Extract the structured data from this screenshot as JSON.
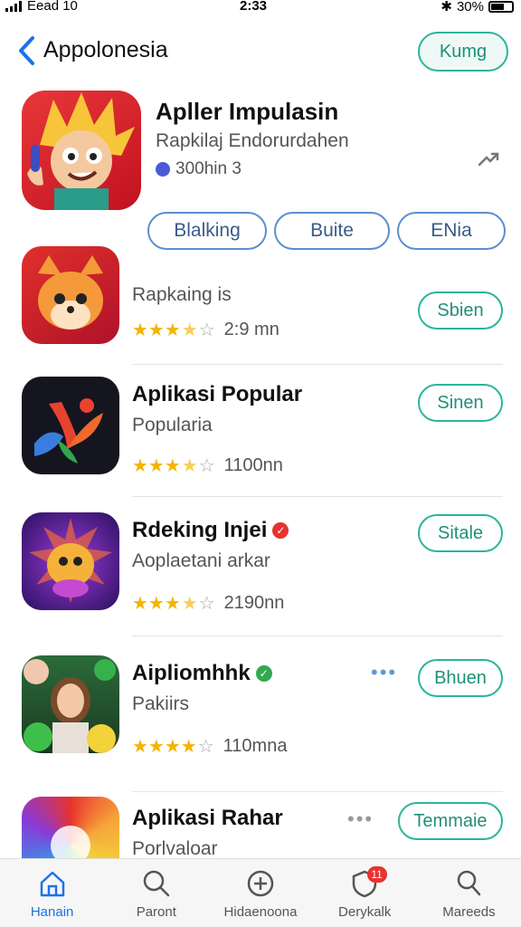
{
  "status": {
    "carrier": "Eead 10",
    "time": "2:33",
    "battery": "30%"
  },
  "header": {
    "title": "Appolonesia",
    "action_label": "Kumg"
  },
  "featured": {
    "title": "Apller Impulasin",
    "subtitle": "Rapkilaj Endorurdahen",
    "count": "300hin 3",
    "tabs": [
      "Blalking",
      "Buite",
      "ENia"
    ]
  },
  "apps": [
    {
      "name": "",
      "subtitle": "Rapkaing is",
      "rating_value": 3.5,
      "rating_text": "2:9 mn",
      "button": "Sbien",
      "badge": "",
      "more": ""
    },
    {
      "name": "Aplikasi Popular",
      "subtitle": "Popularia",
      "rating_value": 3.5,
      "rating_text": "1100nn",
      "button": "Sinen",
      "badge": "",
      "more": ""
    },
    {
      "name": "Rdeking Injei",
      "subtitle": "Aoplaetani arkar",
      "rating_value": 3.5,
      "rating_text": "2190nn",
      "button": "Sitale",
      "badge": "red",
      "more": ""
    },
    {
      "name": "Aipliomhhk",
      "subtitle": "Pakiirs",
      "rating_value": 4.5,
      "rating_text": "110mna",
      "button": "Bhuen",
      "badge": "green",
      "more": "•••"
    },
    {
      "name": "Aplikasi Rahar",
      "subtitle": "Porlvaloar",
      "rating_value": 0,
      "rating_text": "",
      "button": "Temmaie",
      "badge": "",
      "more": "•••"
    }
  ],
  "tabbar": {
    "items": [
      {
        "label": "Hanain",
        "icon": "home-icon",
        "active": true
      },
      {
        "label": "Paront",
        "icon": "search-icon",
        "active": false
      },
      {
        "label": "Hidaenoona",
        "icon": "add-circle-icon",
        "active": false
      },
      {
        "label": "Derykalk",
        "icon": "shield-icon",
        "active": false,
        "badge": "11"
      },
      {
        "label": "Mareeds",
        "icon": "search-icon",
        "active": false
      }
    ]
  },
  "colors": {
    "accent": "#2bb59a",
    "link": "#1a73e8",
    "star": "#f4b400"
  }
}
